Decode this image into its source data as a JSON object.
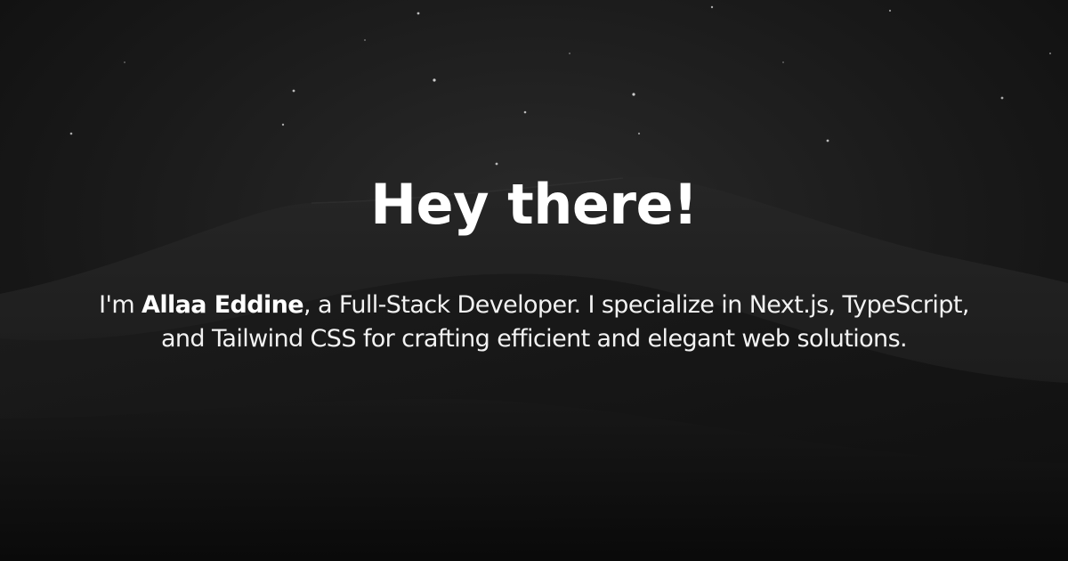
{
  "hero": {
    "heading": "Hey there!",
    "intro_prefix": "I'm ",
    "name": "Allaa Eddine",
    "intro_suffix": ", a Full-Stack Developer.  I specialize in Next.js, TypeScript, and Tailwind CSS for crafting efficient and elegant web solutions."
  },
  "colors": {
    "background": "#1a1a1a",
    "text": "#ffffff"
  }
}
